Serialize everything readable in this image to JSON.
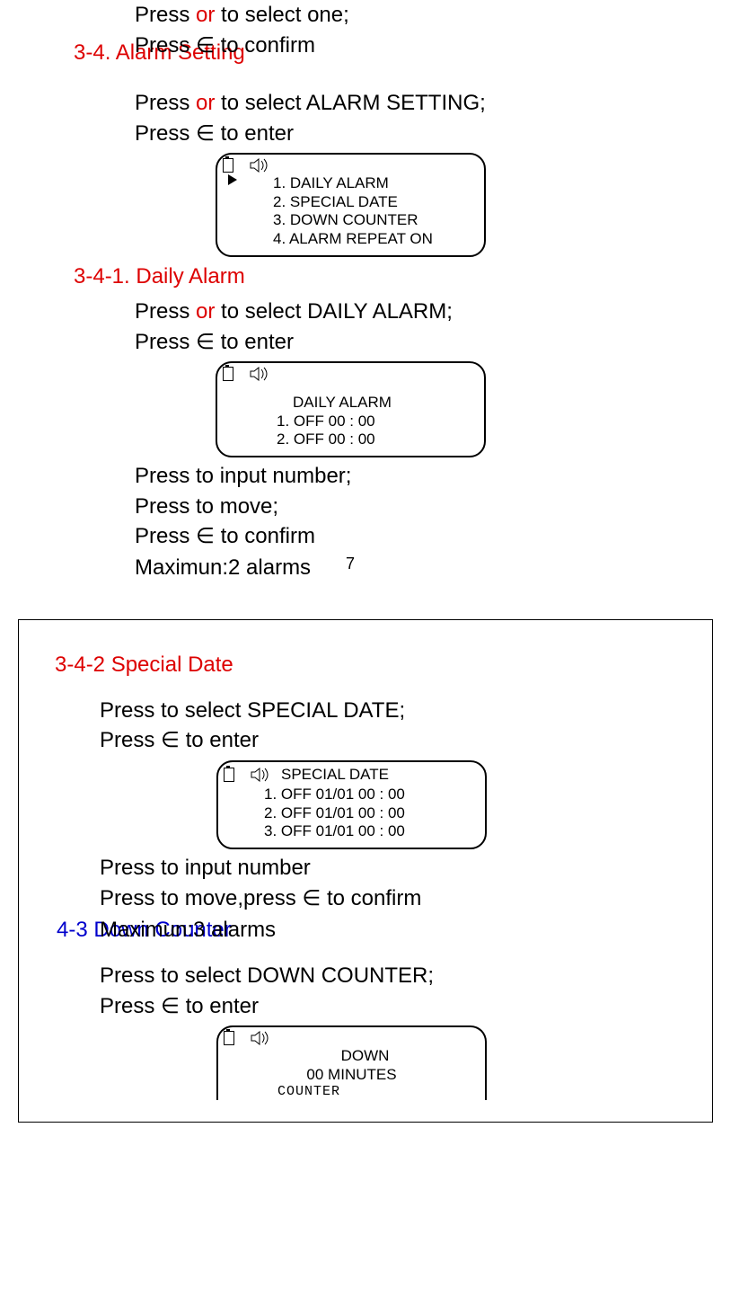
{
  "intro": {
    "line1_a": "Press ",
    "or": "or",
    "line1_b": "    to select one;",
    "line2_a": "Press ",
    "elem": "∈",
    "line2_b": "  to confirm",
    "heading_34": "3-4. Alarm Setting"
  },
  "sec34": {
    "line1_a": "Press ",
    "or": "or",
    "line1_b": "    to select ALARM SETTING;",
    "line2_a": "Press ",
    "elem": "∈",
    "line2_b": " to enter"
  },
  "lcd1": {
    "item1": "1. DAILY ALARM",
    "item2": "2. SPECIAL DATE",
    "item3": "3. DOWN COUNTER",
    "item4": "4. ALARM REPEAT ON"
  },
  "heading_341": "3-4-1. Daily Alarm",
  "sec341": {
    "line1_a": "Press ",
    "or": "or",
    "line1_b": "    to select DAILY ALARM;",
    "line2_a": "Press ",
    "elem": "∈",
    "line2_b": " to enter"
  },
  "lcd2": {
    "title": "DAILY ALARM",
    "item1": "1. OFF 00 : 00",
    "item2": "2. OFF 00 : 00"
  },
  "sec341b": {
    "l1": "Press   to input number;",
    "l2": "Press   to move;",
    "l3a": "Press ",
    "elem": "∈",
    "l3b": " to confirm",
    "l4": "Maximun:2 alarms"
  },
  "page_num": "7",
  "heading_342": "3-4-2 Special Date",
  "sec342": {
    "line1": "Press   to select SPECIAL DATE;",
    "line2_a": "Press ",
    "elem": "∈",
    "line2_b": " to enter"
  },
  "lcd3": {
    "title": "SPECIAL DATE",
    "item1": "1. OFF 01/01 00 : 00",
    "item2": "2. OFF 01/01 00 : 00",
    "item3": "3. OFF 01/01 00 : 00"
  },
  "sec342b": {
    "l1": "Press   to input number",
    "l2a": "Press   to move,press ",
    "elem": "∈",
    "l2b": " to confirm",
    "l3": "Maximun:3 alarms",
    "heading_43": "4-3 Down Counter"
  },
  "sec43": {
    "line1": "Press   to select DOWN COUNTER;",
    "line2_a": "Press ",
    "elem": "∈",
    "line2_b": " to enter"
  },
  "lcd4": {
    "l1": "DOWN",
    "l2": "00 MINUTES",
    "l3": "COUNTER"
  }
}
